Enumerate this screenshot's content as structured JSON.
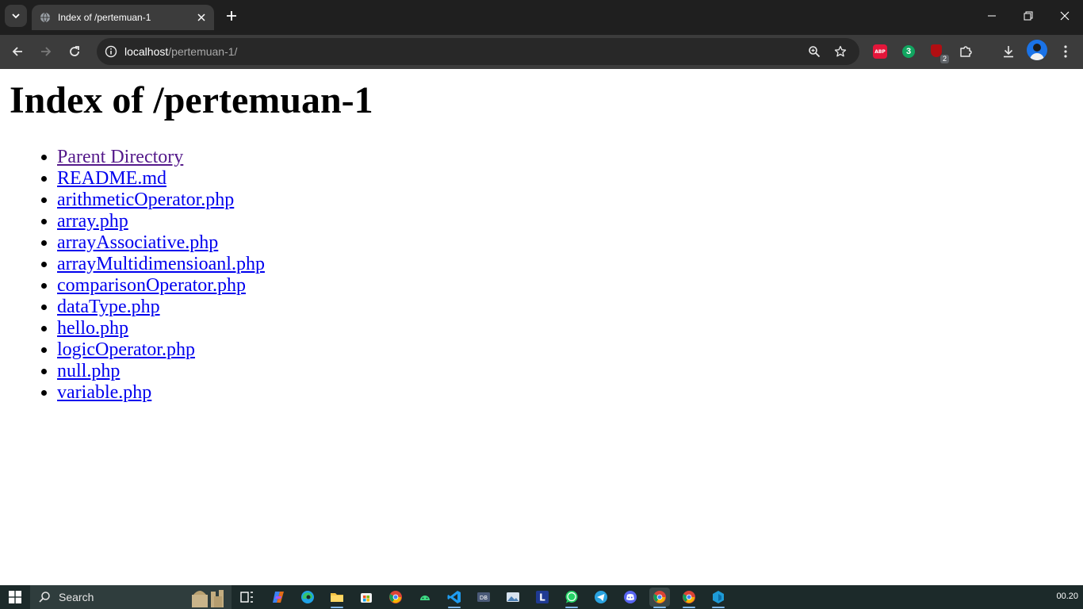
{
  "browser": {
    "tab": {
      "title": "Index of /pertemuan-1"
    },
    "address": {
      "host": "localhost",
      "path": "/pertemuan-1/"
    },
    "extensions": {
      "abp_label": "ABP",
      "three_label": "3",
      "ubo_badge": "2"
    }
  },
  "page": {
    "heading": "Index of /pertemuan-1",
    "entries": [
      {
        "label": "Parent Directory",
        "visited": true
      },
      {
        "label": "README.md"
      },
      {
        "label": "arithmeticOperator.php"
      },
      {
        "label": "array.php"
      },
      {
        "label": "arrayAssociative.php"
      },
      {
        "label": "arrayMultidimensioanl.php"
      },
      {
        "label": "comparisonOperator.php"
      },
      {
        "label": "dataType.php"
      },
      {
        "label": "hello.php"
      },
      {
        "label": "logicOperator.php"
      },
      {
        "label": "null.php"
      },
      {
        "label": "variable.php"
      }
    ],
    "colors": {
      "link": "#0000ee",
      "visited": "#551a8b"
    }
  },
  "taskbar": {
    "search_label": "Search",
    "clock": "00.20",
    "apps": [
      "task-view-icon",
      "copilot-icon",
      "edge-icon",
      "file-explorer-icon",
      "microsoft-store-icon",
      "chrome-icon",
      "android-studio-icon",
      "vscode-icon",
      "app-icon",
      "photos-icon",
      "l-app-icon",
      "whatsapp-icon",
      "telegram-icon",
      "discord-icon",
      "chrome-active-icon",
      "chrome-profile-icon",
      "generic-app-icon"
    ]
  }
}
